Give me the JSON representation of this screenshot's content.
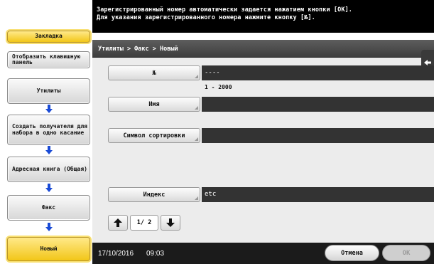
{
  "top_message": {
    "line1": "Зарегистрированный номер автоматически задается нажатием кнопки [OK].",
    "line2": "Для указания зарегистрированного номера нажмите кнопку [№]."
  },
  "sidebar": {
    "bookmark": "Закладка",
    "show_keypad": "Отобразить клавишную панель",
    "steps": [
      "Утилиты",
      "Создать получателя для набора в одно касание",
      "Адресная книга (Общая)",
      "Факс",
      "Новый"
    ]
  },
  "breadcrumb": "Утилиты > Факс > Новый",
  "fields": {
    "number_label": "№",
    "number_value": "----",
    "number_range": "1 - 2000",
    "name_label": "Имя",
    "name_value": "",
    "sort_label": "Символ сортировки",
    "sort_value": "",
    "index_label": "Индекс",
    "index_value": "etc"
  },
  "pager": {
    "page": "1/ 2"
  },
  "status": {
    "date": "17/10/2016",
    "time": "09:03"
  },
  "buttons": {
    "cancel": "Отмена",
    "ok": "OK"
  },
  "colors": {
    "accent_yellow": "#f2c618",
    "arrow_blue": "#1a4bd6"
  }
}
